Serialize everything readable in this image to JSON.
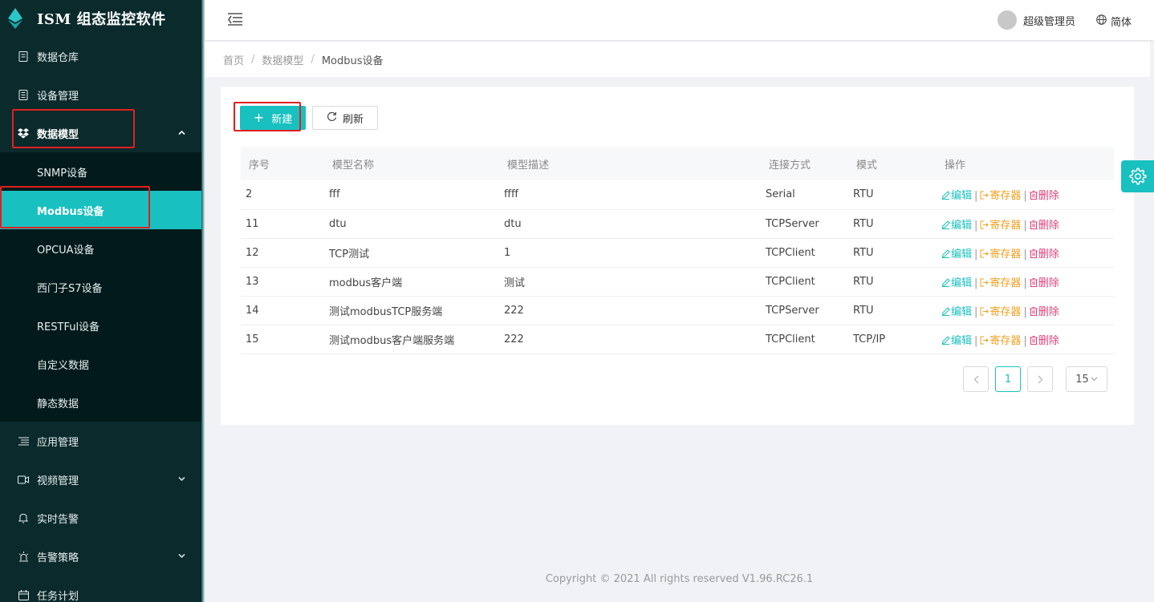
{
  "app": {
    "title": "ISM 组态监控软件"
  },
  "sidebar": {
    "items": [
      {
        "label": "数据仓库",
        "icon": "database-icon"
      },
      {
        "label": "设备管理",
        "icon": "device-icon"
      },
      {
        "label": "数据模型",
        "icon": "dropbox-icon",
        "expanded": true
      },
      {
        "label": "应用管理",
        "icon": "list-icon"
      },
      {
        "label": "视频管理",
        "icon": "video-icon"
      },
      {
        "label": "实时告警",
        "icon": "bell-icon"
      },
      {
        "label": "告警策略",
        "icon": "alarm-light-icon"
      },
      {
        "label": "任务计划",
        "icon": "calendar-icon"
      }
    ],
    "submenu": [
      {
        "label": "SNMP设备"
      },
      {
        "label": "Modbus设备",
        "active": true
      },
      {
        "label": "OPCUA设备"
      },
      {
        "label": "西门子S7设备"
      },
      {
        "label": "RESTFul设备"
      },
      {
        "label": "自定义数据"
      },
      {
        "label": "静态数据"
      }
    ]
  },
  "header": {
    "user": "超级管理员",
    "language": "简体"
  },
  "breadcrumb": [
    "首页",
    "数据模型",
    "Modbus设备"
  ],
  "toolbar": {
    "new_label": "新建",
    "refresh_label": "刷新"
  },
  "table": {
    "headers": [
      "序号",
      "模型名称",
      "模型描述",
      "连接方式",
      "模式",
      "操作"
    ],
    "rows": [
      {
        "id": "2",
        "name": "fff",
        "desc": "ffff",
        "conn": "Serial",
        "mode": "RTU"
      },
      {
        "id": "11",
        "name": "dtu",
        "desc": "dtu",
        "conn": "TCPServer",
        "mode": "RTU"
      },
      {
        "id": "12",
        "name": "TCP测试",
        "desc": "1",
        "conn": "TCPClient",
        "mode": "RTU"
      },
      {
        "id": "13",
        "name": "modbus客户端",
        "desc": "测试",
        "conn": "TCPClient",
        "mode": "RTU"
      },
      {
        "id": "14",
        "name": "测试modbusTCP服务端",
        "desc": "222",
        "conn": "TCPServer",
        "mode": "RTU"
      },
      {
        "id": "15",
        "name": "测试modbus客户端服务端",
        "desc": "222",
        "conn": "TCPClient",
        "mode": "TCP/IP"
      }
    ],
    "ops": {
      "edit": "编辑",
      "register": "寄存器",
      "delete": "删除"
    }
  },
  "pagination": {
    "current": "1",
    "page_size": "15"
  },
  "footer": {
    "copyright": "Copyright © 2021 All rights reserved V1.96.RC26.1"
  },
  "colors": {
    "accent": "#19c0c0",
    "sidebar_bg": "#0b2a2c",
    "submenu_bg": "#021a1b",
    "warning": "#f0a020",
    "danger": "#e0407a",
    "highlight_box": "#e02020"
  }
}
